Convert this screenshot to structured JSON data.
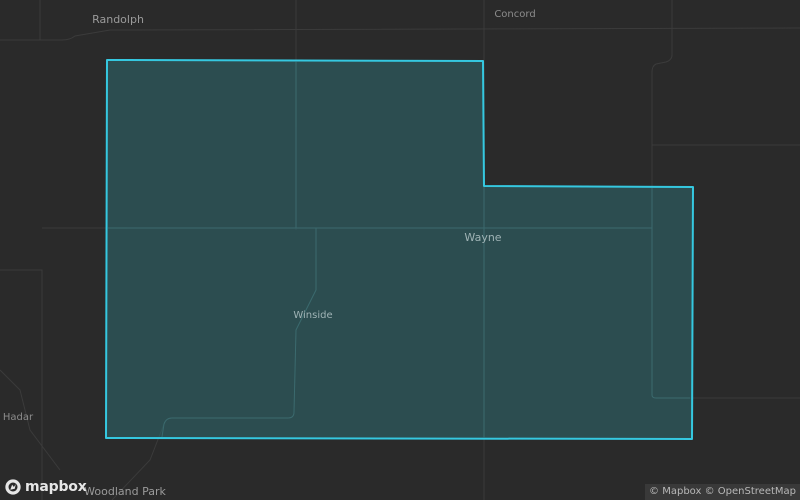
{
  "map": {
    "background": "#2a2a2a",
    "road_color": "#3b3b3b",
    "region_fill": "#2e6a70",
    "region_fill_opacity": 0.5,
    "region_stroke": "#35c8e0"
  },
  "places": [
    {
      "name": "Randolph",
      "kind": "town"
    },
    {
      "name": "Concord",
      "kind": "village"
    },
    {
      "name": "Wayne",
      "kind": "town"
    },
    {
      "name": "Winside",
      "kind": "village"
    },
    {
      "name": "Hadar",
      "kind": "village"
    },
    {
      "name": "Woodland Park",
      "kind": "town"
    }
  ],
  "logo": {
    "text": "mapbox",
    "icon": "mapbox-logo-icon"
  },
  "attribution": {
    "copyright": "©",
    "mapbox": "Mapbox",
    "osm": "OpenStreetMap"
  }
}
